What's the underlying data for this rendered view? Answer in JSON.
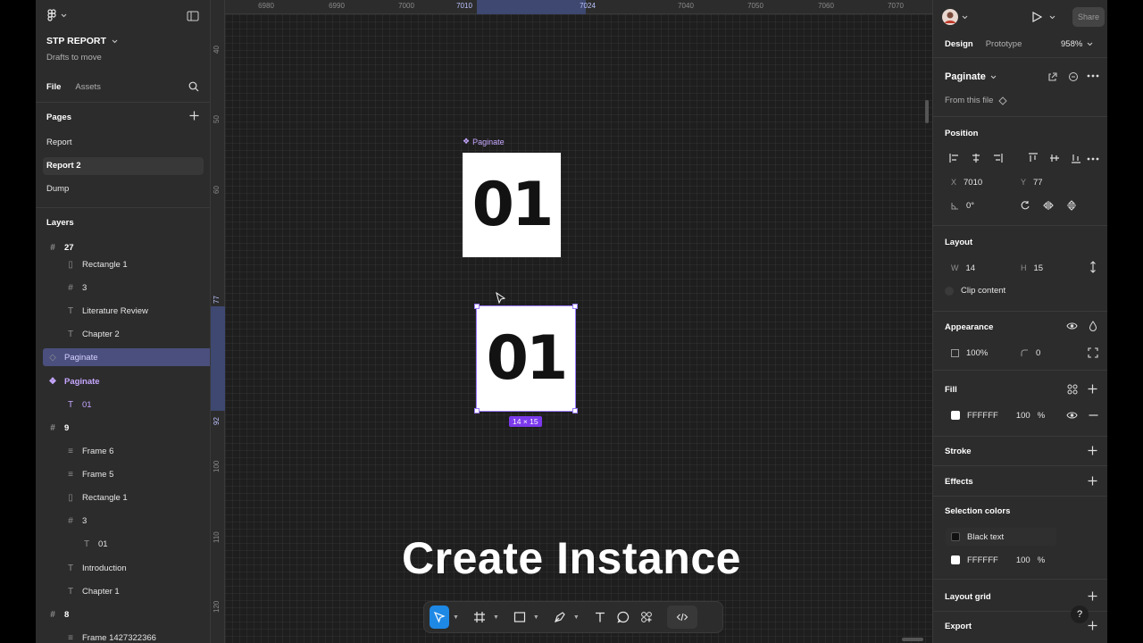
{
  "left": {
    "file_name": "STP REPORT",
    "subtitle": "Drafts to move",
    "tabs": [
      "File",
      "Assets"
    ],
    "pages_title": "Pages",
    "pages": [
      "Report",
      "Report 2",
      "Dump"
    ],
    "layers_title": "Layers",
    "layers": [
      {
        "label": "27"
      },
      {
        "label": "Rectangle 1"
      },
      {
        "label": "3"
      },
      {
        "label": "Literature Review"
      },
      {
        "label": "Chapter 2"
      },
      {
        "label": "Paginate"
      },
      {
        "label": "Paginate"
      },
      {
        "label": "01"
      },
      {
        "label": "9"
      },
      {
        "label": "Frame 6"
      },
      {
        "label": "Frame 5"
      },
      {
        "label": "Rectangle 1"
      },
      {
        "label": "3"
      },
      {
        "label": "01"
      },
      {
        "label": "Introduction"
      },
      {
        "label": "Chapter 1"
      },
      {
        "label": "8"
      },
      {
        "label": "Frame 1427322366"
      }
    ]
  },
  "canvas": {
    "ruler_top": [
      "6980",
      "6990",
      "7000",
      "7010",
      "7024",
      "7040",
      "7050",
      "7060",
      "7070"
    ],
    "ruler_left": [
      "40",
      "50",
      "60",
      "77",
      "92",
      "100",
      "110",
      "120"
    ],
    "frame_label": "Paginate",
    "card1_text": "01",
    "card2_text": "01",
    "dimension_badge": "14 × 15",
    "caption": "Create Instance"
  },
  "right": {
    "tabs": [
      "Design",
      "Prototype"
    ],
    "zoom": "958%",
    "share": "Share",
    "component_name": "Paginate",
    "from_file": "From this file",
    "position_title": "Position",
    "x_label": "X",
    "x": "7010",
    "y_label": "Y",
    "y": "77",
    "rotation": "0°",
    "layout_title": "Layout",
    "w_label": "W",
    "w": "14",
    "h_label": "H",
    "h": "15",
    "clip_content": "Clip content",
    "appearance_title": "Appearance",
    "opacity": "100%",
    "radius": "0",
    "fill_title": "Fill",
    "fill_hex": "FFFFFF",
    "fill_opacity": "100",
    "percent": "%",
    "stroke_title": "Stroke",
    "effects_title": "Effects",
    "selection_colors_title": "Selection colors",
    "sel_color_1": "Black text",
    "sel_color_2": "FFFFFF",
    "sel_color_2_opacity": "100",
    "layout_grid_title": "Layout grid",
    "export_title": "Export",
    "help": "?"
  },
  "colors": {
    "accent": "#1e88e5",
    "component": "#c6a7ff",
    "selection": "#9b7bff",
    "badge": "#7c3aed"
  }
}
